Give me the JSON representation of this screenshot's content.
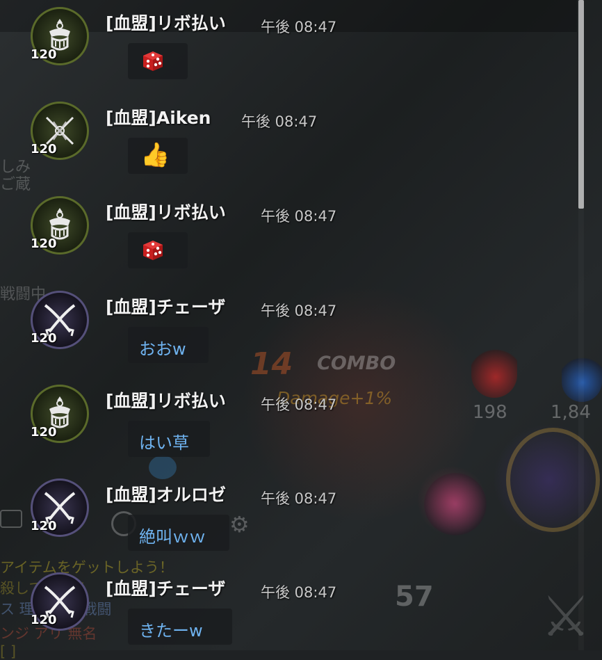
{
  "chat": {
    "messages": [
      {
        "sender": "[血盟]リボ払い",
        "time": "午後 08:47",
        "level": "120",
        "avatar": "crown-crest-icon",
        "kind": "stamp",
        "stamp": "dice-icon"
      },
      {
        "sender": "[血盟]Aiken",
        "time": "午後 08:47",
        "level": "120",
        "avatar": "crossed-swords-icon",
        "kind": "stamp",
        "stamp": "thumbs-up-icon",
        "stamp_glyph": "👍"
      },
      {
        "sender": "[血盟]リボ払い",
        "time": "午後 08:47",
        "level": "120",
        "avatar": "crown-crest-icon",
        "kind": "stamp",
        "stamp": "dice-icon"
      },
      {
        "sender": "[血盟]チェーザ",
        "time": "午後 08:47",
        "level": "120",
        "avatar": "crossed-sabers-icon",
        "kind": "text",
        "text": "おおw"
      },
      {
        "sender": "[血盟]リボ払い",
        "time": "午後 08:47",
        "level": "120",
        "avatar": "crown-crest-icon",
        "kind": "text",
        "text": "はい草"
      },
      {
        "sender": "[血盟]オルロゼ",
        "time": "午後 08:47",
        "level": "120",
        "avatar": "crossed-sabers-icon",
        "kind": "text",
        "text": "絶叫ｗｗ"
      },
      {
        "sender": "[血盟]チェーザ",
        "time": "午後 08:47",
        "level": "120",
        "avatar": "crossed-sabers-icon",
        "kind": "text",
        "text": "きたーw"
      }
    ]
  },
  "hud": {
    "combo_count": "14",
    "combo_label": "COMBO",
    "combo_bonus": "Damage+1%",
    "red_potion_count": "198",
    "blue_potion_count": "1,84",
    "skill_counter": "57",
    "side_text_1": "しみ",
    "side_text_2": "ご蔵",
    "side_text_3": "戦闘中",
    "notice_1": "アイテムをゲットしよう！",
    "notice_2": "殺してアイテ",
    "notice_3": "ス   理人 召喚戦闘",
    "notice_4": "ンジ   アリ   無名",
    "notice_5": "   [    ]"
  },
  "colors": {
    "message_text": "#6fb3f0",
    "name_text": "#f2f2f2",
    "time_text": "#c9c9c9",
    "scroll_thumb": "#dcdcdc"
  }
}
